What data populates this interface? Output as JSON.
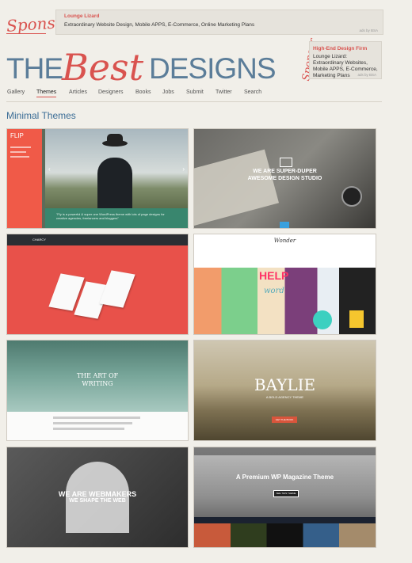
{
  "sponsor_top": {
    "label": "Sponsor",
    "ad_title": "Lounge Lizard",
    "ad_text": "Extraordinary Website Design, Mobile APPS, E-Commerce, Online Marketing Plans",
    "ads_by": "ads by BSA"
  },
  "logo": {
    "the": "THE",
    "best": "Best",
    "designs": "DESIGNS"
  },
  "sponsor_right": {
    "label": "Sponsor",
    "ad_title": "High-End Design Firm",
    "ad_text": "Lounge Lizard: Extraordinary Websites, Mobile APPS, E-Commerce, Marketing Plans",
    "ads_by": "ads by BSA"
  },
  "nav": {
    "items": [
      "Gallery",
      "Themes",
      "Articles",
      "Designers",
      "Books",
      "Jobs",
      "Submit",
      "Twitter",
      "Search"
    ],
    "active": "Themes"
  },
  "section_title": "Minimal Themes",
  "thumbs": {
    "flip": {
      "logo": "FLIP",
      "caption": "\"Fly is a powerful & super one WordPress theme with lots of page designs for creative agencies, freelancers and bloggers\""
    },
    "studio": {
      "title_line1": "WE ARE SUPER-DUPER",
      "title_line2": "AWESOME DESIGN STUDIO"
    },
    "charcy": {
      "brand": "CHARCY"
    },
    "wonder": {
      "brand": "Wonder",
      "help": "HELP",
      "word": "word"
    },
    "writing": {
      "title_line1": "THE ART OF",
      "title_line2": "WRITING"
    },
    "baylie": {
      "title": "BAYLIE",
      "subtitle": "A BOLD AGENCY THEME",
      "button": "GET THE BOOK"
    },
    "webmakers": {
      "title_line1": "WE ARE WEBMAKERS",
      "title_line2": "WE SHAPE THE WEB"
    },
    "magazine": {
      "title": "A Premium WP Magazine Theme",
      "button": "SEE THIS THEME"
    }
  }
}
